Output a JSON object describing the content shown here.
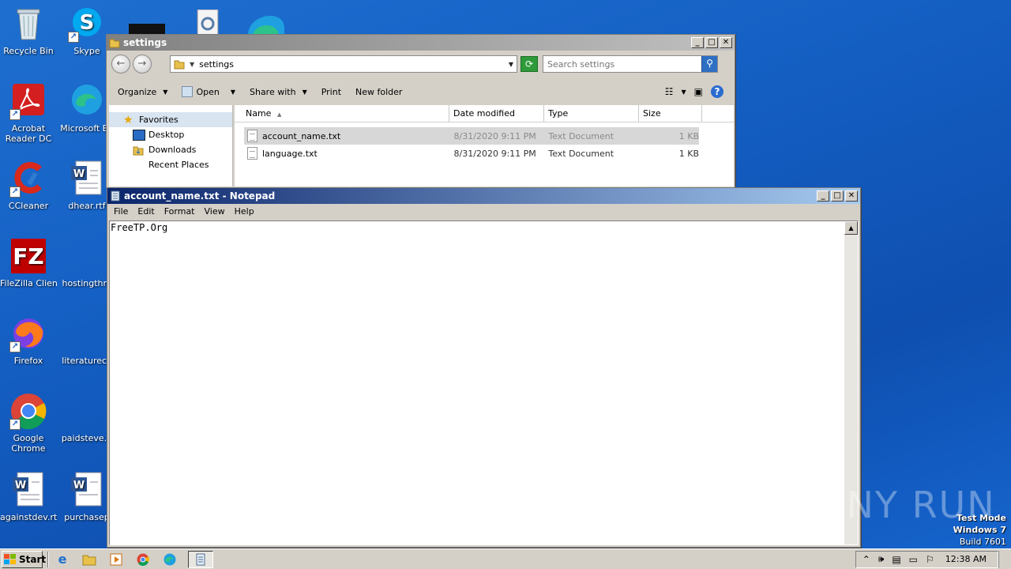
{
  "desktop": {
    "icons": [
      {
        "label": "Recycle Bin"
      },
      {
        "label": "Skype"
      },
      {
        "label": "Acrobat Reader DC"
      },
      {
        "label": "Microsoft Ed"
      },
      {
        "label": "CCleaner"
      },
      {
        "label": "dhear.rtf"
      },
      {
        "label": "FileZilla Client"
      },
      {
        "label": "hostingthro"
      },
      {
        "label": "Firefox"
      },
      {
        "label": "literatureca"
      },
      {
        "label": "Google Chrome"
      },
      {
        "label": "paidsteve.p"
      },
      {
        "label": "againstdev.rtf"
      },
      {
        "label": "purchasep"
      }
    ]
  },
  "explorer": {
    "title": "settings",
    "address": "settings",
    "search_placeholder": "Search settings",
    "toolbar": {
      "organize": "Organize",
      "open": "Open",
      "share_with": "Share with",
      "print": "Print",
      "new_folder": "New folder"
    },
    "nav": {
      "favorites": "Favorites",
      "items": [
        "Desktop",
        "Downloads",
        "Recent Places"
      ]
    },
    "columns": {
      "name": "Name",
      "date": "Date modified",
      "type": "Type",
      "size": "Size"
    },
    "files": [
      {
        "name": "account_name.txt",
        "date": "8/31/2020 9:11 PM",
        "type": "Text Document",
        "size": "1 KB"
      },
      {
        "name": "language.txt",
        "date": "8/31/2020 9:11 PM",
        "type": "Text Document",
        "size": "1 KB"
      }
    ]
  },
  "notepad": {
    "title": "account_name.txt - Notepad",
    "menu": [
      "File",
      "Edit",
      "Format",
      "View",
      "Help"
    ],
    "content": "FreeTP.Org"
  },
  "watermark": {
    "text": "ANY RUN",
    "mode": "Test Mode",
    "os": "Windows 7",
    "build": "Build 7601"
  },
  "taskbar": {
    "start": "Start",
    "clock": "12:38 AM"
  }
}
